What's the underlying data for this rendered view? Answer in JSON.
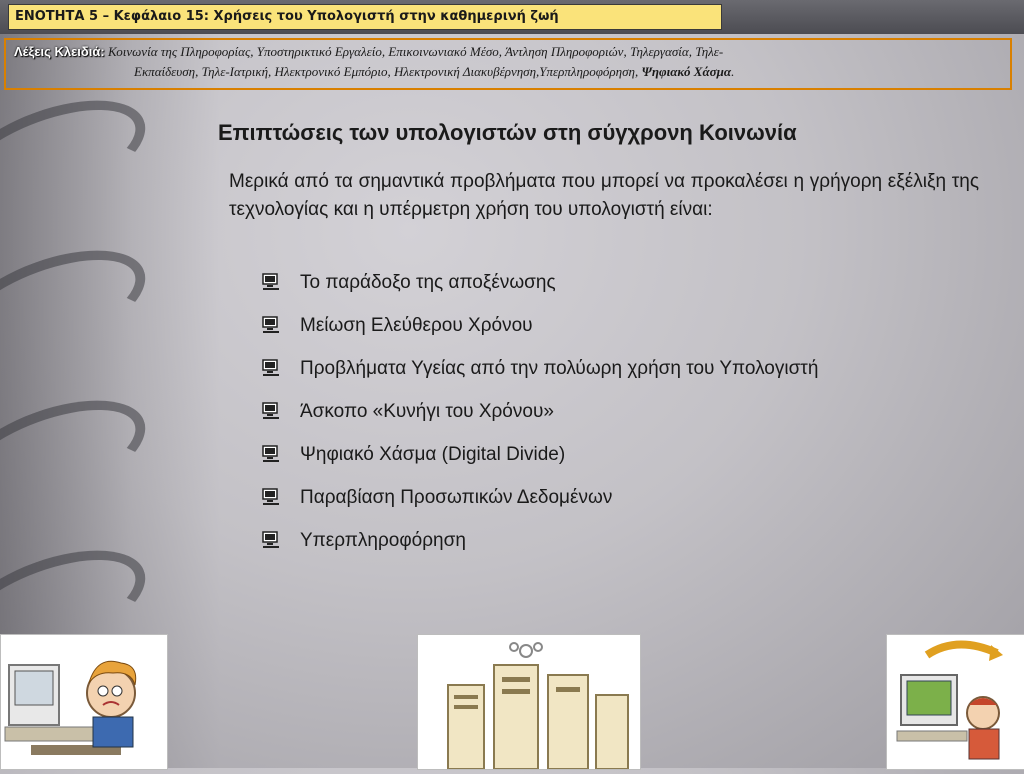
{
  "header": {
    "title": "ΕΝΟΤΗΤΑ 5 – Κεφάλαιο 15: Χρήσεις του Υπολογιστή στην καθημερινή ζωή"
  },
  "keywords": {
    "label": "Λέξεις Κλειδιά:",
    "line1": "Κοινωνία της Πληροφορίας, Υποστηρικτικό Εργαλείο, Επικοινωνιακό Μέσο, Άντληση Πληροφοριών, Τηλεργασία, Τηλε-",
    "line2": "Εκπαίδευση, Τηλε-Ιατρική, Ηλεκτρονικό Εμπόριο, Ηλεκτρονική Διακυβέρνηση,Υπερπληροφόρηση,",
    "emphasis": "Ψηφιακό Χάσμα",
    "end": "."
  },
  "main": {
    "heading": "Επιπτώσεις των υπολογιστών στη σύγχρονη Κοινωνία",
    "intro": "Μερικά από τα σημαντικά προβλήματα που μπορεί να προκαλέσει η γρήγορη εξέλιξη της τεχνολογίας και η υπέρμετρη χρήση του υπολογιστή είναι:",
    "bullets": [
      "Το παράδοξο της αποξένωσης",
      "Μείωση Ελεύθερου Χρόνου",
      "Προβλήματα Υγείας από την πολύωρη χρήση του Υπολογιστή",
      "Άσκοπο «Κυνήγι του Χρόνου»",
      "Ψηφιακό Χάσμα (Digital Divide)",
      "Παραβίαση Προσωπικών Δεδομένων",
      "Υπερπληροφόρηση"
    ]
  },
  "icons": {
    "bullet": "computer-icon"
  },
  "colors": {
    "title_bg": "#fae37a",
    "keywords_border": "#d98000"
  }
}
